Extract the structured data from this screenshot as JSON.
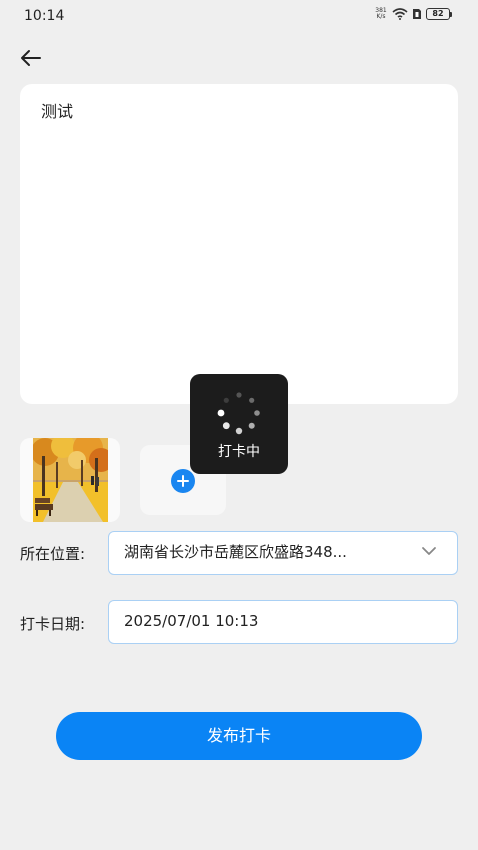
{
  "status_bar": {
    "time": "10:14",
    "net_speed_value": "381",
    "net_speed_unit": "K/s",
    "battery": "82"
  },
  "content": {
    "text": "测试"
  },
  "images": {
    "icons": [
      "photo-thumbnail",
      "add-icon"
    ]
  },
  "form": {
    "location_label": "所在位置:",
    "location_value": "湖南省长沙市岳麓区欣盛路348...",
    "date_label": "打卡日期:",
    "date_value": "2025/07/01 10:13"
  },
  "submit_label": "发布打卡",
  "loading": {
    "text": "打卡中"
  },
  "colors": {
    "accent": "#0a84f5",
    "background": "#efefef",
    "field_border": "#aad0f4",
    "toast": "#1c1c1c"
  }
}
